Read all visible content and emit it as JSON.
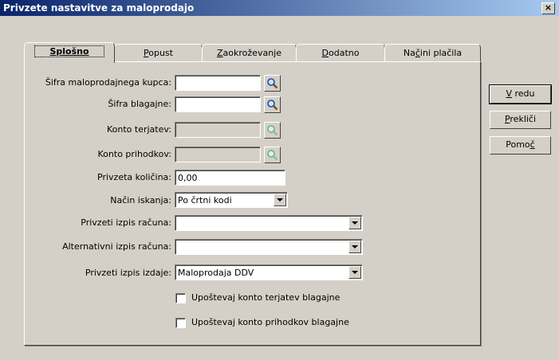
{
  "window": {
    "title": "Privzete nastavitve za maloprodajo",
    "close_label": "×"
  },
  "tabs": [
    {
      "pre": "",
      "key": "S",
      "post": "plošno"
    },
    {
      "pre": "",
      "key": "P",
      "post": "opust"
    },
    {
      "pre": "",
      "key": "Z",
      "post": "aokroževanje"
    },
    {
      "pre": "",
      "key": "D",
      "post": "odatno"
    },
    {
      "pre": "Na",
      "key": "č",
      "post": "ini plačila"
    }
  ],
  "form": {
    "sifra_kupca": {
      "label": "Šifra maloprodajnega kupca:",
      "value": ""
    },
    "sifra_blagajne": {
      "label": "Šifra blagajne:",
      "value": ""
    },
    "konto_terjatev": {
      "label": "Konto terjatev:",
      "value": ""
    },
    "konto_prihodkov": {
      "label": "Konto prihodkov:",
      "value": ""
    },
    "kolicina": {
      "label": "Privzeta količina:",
      "value": "0,00"
    },
    "nacin_iskanja": {
      "label": "Način iskanja:",
      "value": "Po črtni kodi"
    },
    "izpis_racuna": {
      "label": "Privzeti izpis računa:",
      "value": ""
    },
    "alt_izpis_racuna": {
      "label": "Alternativni izpis računa:",
      "value": ""
    },
    "izpis_izdaje": {
      "label": "Privzeti izpis izdaje:",
      "value": "Maloprodaja DDV"
    },
    "cb_terjatev": {
      "label": "Upoštevaj konto terjatev blagajne",
      "checked": false
    },
    "cb_prihodkov": {
      "label": "Upoštevaj konto prihodkov blagajne",
      "checked": false
    }
  },
  "buttons": {
    "ok": {
      "key": "V",
      "post": " redu"
    },
    "cancel": {
      "key": "P",
      "post": "rekliči"
    },
    "help": {
      "pre": "Pomo",
      "key": "č",
      "post": ""
    }
  },
  "icons": {
    "lookup": "magnifier-icon",
    "dropdown": "chevron-down-icon"
  }
}
